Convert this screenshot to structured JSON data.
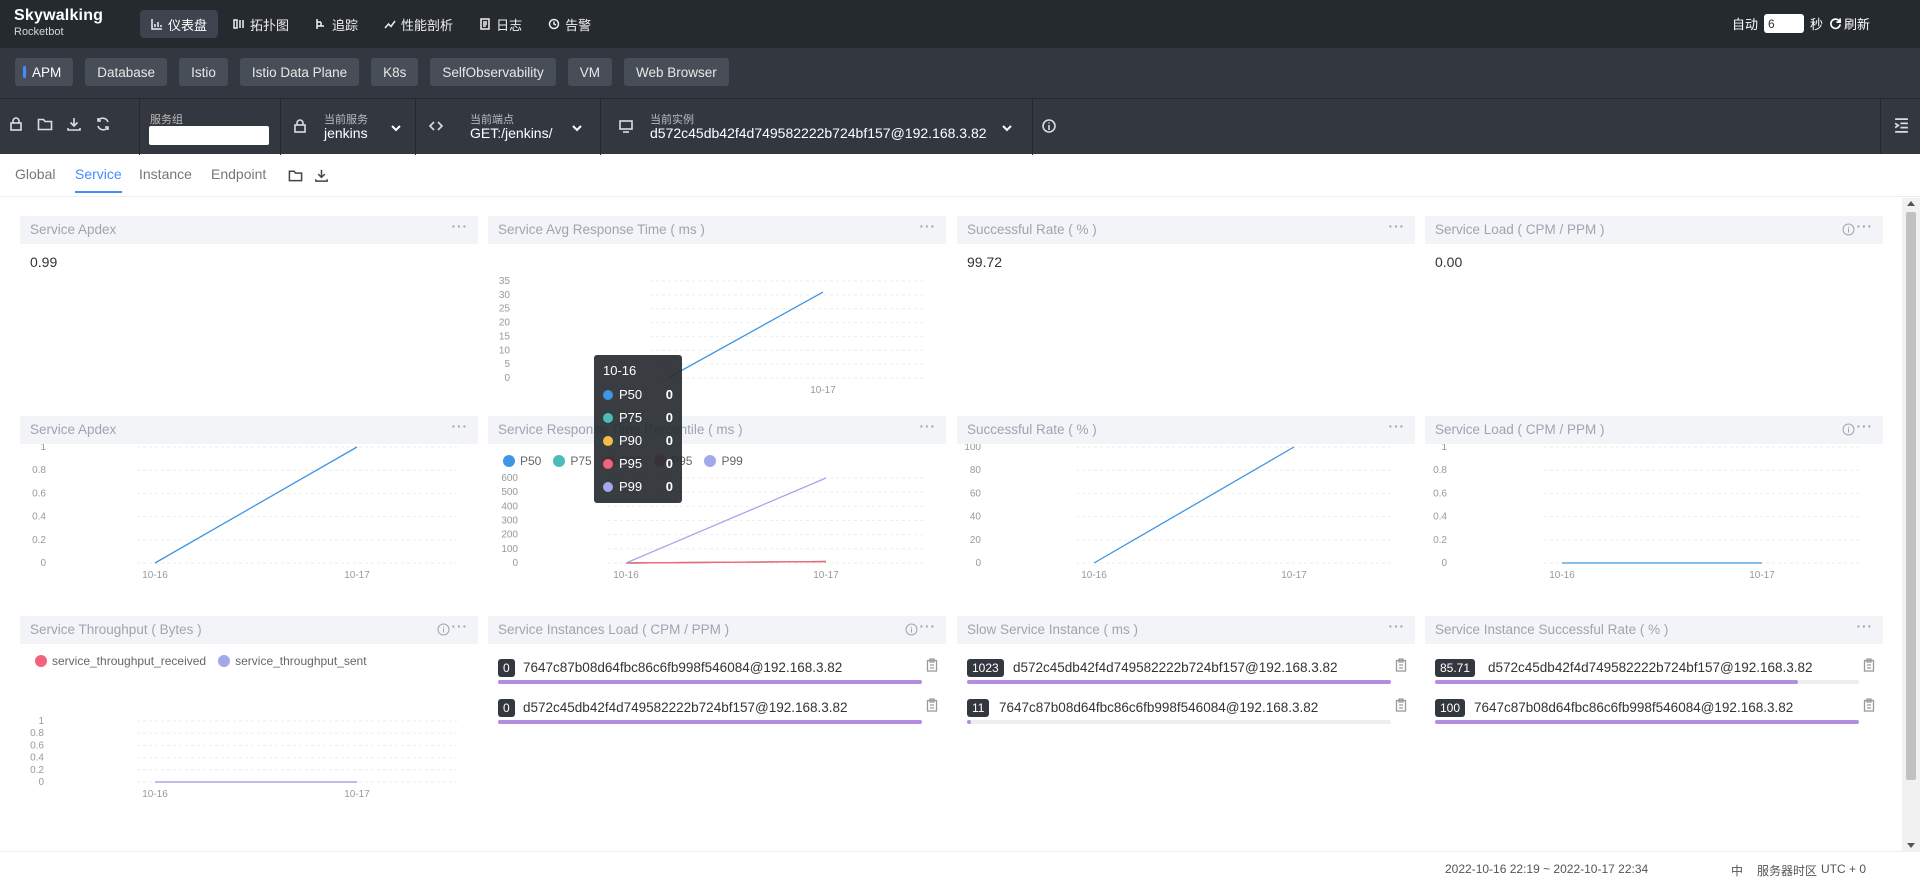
{
  "topbar": {
    "logo_line1": "Skywalking",
    "logo_line2": "Rocketbot",
    "nav": [
      "仪表盘",
      "拓扑图",
      "追踪",
      "性能剖析",
      "日志",
      "告警"
    ],
    "auto_label": "自动",
    "interval_value": "6",
    "seconds_label": "秒",
    "refresh_label": "刷新"
  },
  "layers": [
    "APM",
    "Database",
    "Istio",
    "Istio Data Plane",
    "K8s",
    "SelfObservability",
    "VM",
    "Web Browser"
  ],
  "selectors": {
    "group_label": "服务组",
    "service_label": "当前服务",
    "service_value": "jenkins",
    "endpoint_label": "当前端点",
    "endpoint_value": "GET:/jenkins/",
    "instance_label": "当前实例",
    "instance_value": "d572c45db42f4d749582222b724bf157@192.168.3.82"
  },
  "tabs": [
    "Global",
    "Service",
    "Instance",
    "Endpoint"
  ],
  "cards": {
    "apdex": {
      "title": "Service Apdex",
      "value": "0.99"
    },
    "avg_resp": {
      "title": "Service Avg Response Time ( ms )"
    },
    "success": {
      "title": "Successful Rate ( % )",
      "value": "99.72"
    },
    "load": {
      "title": "Service Load ( CPM / PPM )",
      "value": "0.00"
    },
    "apdex2": {
      "title": "Service Apdex"
    },
    "percentile": {
      "title": "Service Response Time Percentile ( ms )"
    },
    "success2": {
      "title": "Successful Rate ( % )"
    },
    "load2": {
      "title": "Service Load ( CPM / PPM )"
    },
    "throughput": {
      "title": "Service Throughput ( Bytes )"
    },
    "instances_load": {
      "title": "Service Instances Load ( CPM / PPM )"
    },
    "slow_instance": {
      "title": "Slow Service Instance ( ms )"
    },
    "instance_success": {
      "title": "Service Instance Successful Rate ( % )"
    }
  },
  "chart_data": [
    {
      "type": "line",
      "title": "Service Avg Response Time ( ms )",
      "x": [
        "10-16",
        "10-17"
      ],
      "series": [
        {
          "values": [
            0,
            31
          ]
        }
      ],
      "ylim": [
        0,
        35
      ],
      "yticks": [
        0,
        5,
        10,
        15,
        20,
        25,
        30,
        35
      ],
      "xticks_shown": [
        "10-17"
      ]
    },
    {
      "type": "line",
      "title": "Service Apdex",
      "x": [
        "10-16",
        "10-17"
      ],
      "series": [
        {
          "values": [
            0,
            1
          ]
        }
      ],
      "ylim": [
        0,
        1
      ],
      "yticks": [
        0,
        0.2,
        0.4,
        0.6,
        0.8,
        1
      ]
    },
    {
      "type": "line",
      "title": "Service Response Time Percentile ( ms )",
      "x": [
        "10-16",
        "10-17"
      ],
      "series": [
        {
          "name": "P50",
          "values": [
            0,
            10
          ]
        },
        {
          "name": "P75",
          "values": [
            0,
            10
          ]
        },
        {
          "name": "P90",
          "values": [
            0,
            10
          ]
        },
        {
          "name": "P95",
          "values": [
            0,
            10
          ]
        },
        {
          "name": "P99",
          "values": [
            0,
            600
          ]
        }
      ],
      "ylim": [
        0,
        600
      ],
      "yticks": [
        0,
        100,
        200,
        300,
        400,
        500,
        600
      ]
    },
    {
      "type": "line",
      "title": "Successful Rate ( % )",
      "x": [
        "10-16",
        "10-17"
      ],
      "series": [
        {
          "values": [
            0,
            100
          ]
        }
      ],
      "ylim": [
        0,
        100
      ],
      "yticks": [
        0,
        20,
        40,
        60,
        80,
        100
      ]
    },
    {
      "type": "line",
      "title": "Service Load ( CPM / PPM )",
      "x": [
        "10-16",
        "10-17"
      ],
      "series": [
        {
          "values": [
            0,
            0
          ]
        }
      ],
      "ylim": [
        0,
        1
      ],
      "yticks": [
        0,
        0.2,
        0.4,
        0.6,
        0.8,
        1
      ]
    },
    {
      "type": "line",
      "title": "Service Throughput ( Bytes )",
      "x": [
        "10-16",
        "10-17"
      ],
      "series": [
        {
          "name": "service_throughput_received",
          "values": [
            0,
            0
          ]
        },
        {
          "name": "service_throughput_sent",
          "values": [
            0,
            0
          ]
        }
      ],
      "ylim": [
        0,
        1
      ],
      "yticks": [
        0,
        0.2,
        0.4,
        0.6,
        0.8,
        1
      ]
    }
  ],
  "colors": {
    "blue": "#3f96e3",
    "teal": "#4cbcb8",
    "orange": "#f7bd46",
    "red": "#f4637b",
    "purple": "#a3a8e8",
    "accent": "#448dfe"
  },
  "tooltip": {
    "title": "10-16",
    "rows": [
      {
        "name": "P50",
        "value": "0"
      },
      {
        "name": "P75",
        "value": "0"
      },
      {
        "name": "P90",
        "value": "0"
      },
      {
        "name": "P95",
        "value": "0"
      },
      {
        "name": "P99",
        "value": "0"
      }
    ]
  },
  "instance_lists": {
    "load": [
      {
        "value": "0",
        "name": "7647c87b08d64fbc86c6fb998f546084@192.168.3.82",
        "pct": 1.0
      },
      {
        "value": "0",
        "name": "d572c45db42f4d749582222b724bf157@192.168.3.82",
        "pct": 1.0
      }
    ],
    "slow": [
      {
        "value": "1023",
        "name": "d572c45db42f4d749582222b724bf157@192.168.3.82",
        "pct": 1.0
      },
      {
        "value": "11",
        "name": "7647c87b08d64fbc86c6fb998f546084@192.168.3.82",
        "pct": 0.01
      }
    ],
    "success": [
      {
        "value": "85.71",
        "name": "d572c45db42f4d749582222b724bf157@192.168.3.82",
        "pct": 0.857
      },
      {
        "value": "100",
        "name": "7647c87b08d64fbc86c6fb998f546084@192.168.3.82",
        "pct": 1.0
      }
    ]
  },
  "footer": {
    "time_range": "2022-10-16 22:19 ~ 2022-10-17 22:34",
    "lang": "中",
    "tz_label": "服务器时区",
    "tz_value": "UTC + 0"
  }
}
